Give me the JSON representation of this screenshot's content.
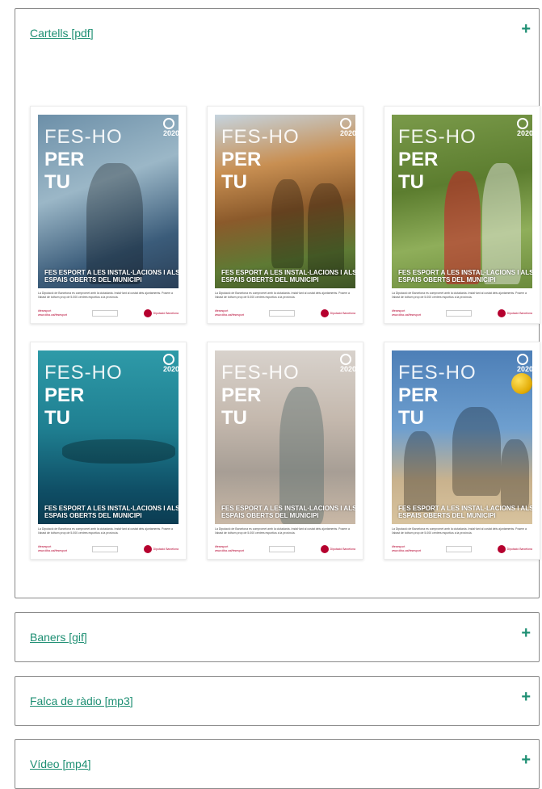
{
  "sections": [
    {
      "title": "Cartells [pdf]",
      "toggle": "+"
    },
    {
      "title": "Baners [gif]",
      "toggle": "+"
    },
    {
      "title": "Falca de ràdio [mp3]",
      "toggle": "+"
    },
    {
      "title": "Vídeo [mp4]",
      "toggle": "+"
    }
  ],
  "poster": {
    "headline_thin": "FES-HO",
    "headline_bold_1": "PER",
    "headline_bold_2": "TU",
    "tagline": "FES ESPORT A LES INSTAL·LACIONS I ALS ESPAIS OBERTS DEL MUNICIPI",
    "caption": "La Diputació de Barcelona es compromet amb la ciutadania. Instal·lant al costat dels ajuntaments. Posem a l'abast de tothom prop de 5.000 centres esportius a la província.",
    "hashtag": "#fesesport",
    "url": "www.diba.cat/fesesport",
    "org_name": "Diputació Barcelona",
    "badge_year": "2020"
  },
  "colors": {
    "accent": "#1e8f73",
    "brand": "#b5002e"
  }
}
